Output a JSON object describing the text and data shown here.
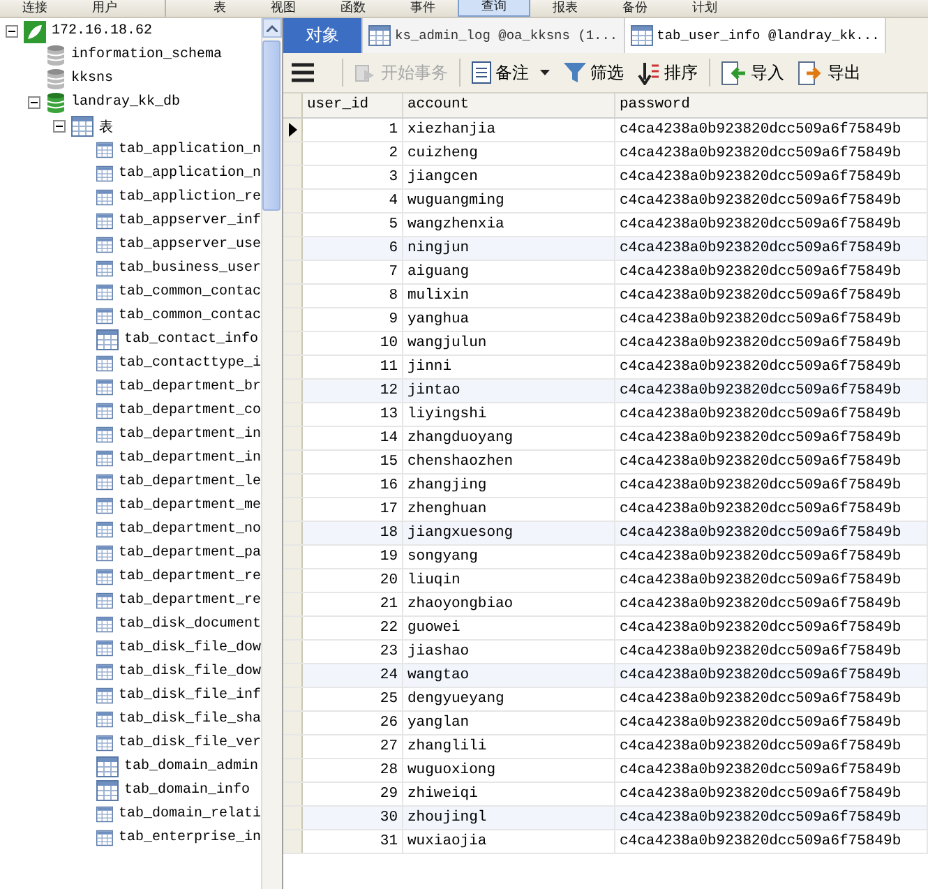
{
  "menu_bar": {
    "items": [
      {
        "label": "连接",
        "selected": false
      },
      {
        "label": "用户",
        "selected": false
      },
      {
        "label": "表",
        "selected": false
      },
      {
        "label": "视图",
        "selected": false
      },
      {
        "label": "函数",
        "selected": false
      },
      {
        "label": "事件",
        "selected": false
      },
      {
        "label": "查询",
        "selected": true
      },
      {
        "label": "报表",
        "selected": false
      },
      {
        "label": "备份",
        "selected": false
      },
      {
        "label": "计划",
        "selected": false
      }
    ]
  },
  "tree": {
    "items": [
      {
        "label": "172.16.18.62",
        "kind": "server",
        "expanded": true,
        "children": [
          {
            "label": "information_schema",
            "kind": "database"
          },
          {
            "label": "kksns",
            "kind": "database"
          },
          {
            "label": "landray_kk_db",
            "kind": "database",
            "expanded": true,
            "children": [
              {
                "label": "表",
                "kind": "folder",
                "expanded": true,
                "children": [
                  {
                    "label": "tab_application_n",
                    "kind": "table"
                  },
                  {
                    "label": "tab_application_n",
                    "kind": "table"
                  },
                  {
                    "label": "tab_appliction_re",
                    "kind": "table"
                  },
                  {
                    "label": "tab_appserver_inf",
                    "kind": "table"
                  },
                  {
                    "label": "tab_appserver_use",
                    "kind": "table"
                  },
                  {
                    "label": "tab_business_user",
                    "kind": "table"
                  },
                  {
                    "label": "tab_common_contac",
                    "kind": "table"
                  },
                  {
                    "label": "tab_common_contac",
                    "kind": "table"
                  },
                  {
                    "label": "tab_contact_info",
                    "kind": "table"
                  },
                  {
                    "label": "tab_contacttype_i",
                    "kind": "table"
                  },
                  {
                    "label": "tab_department_br",
                    "kind": "table"
                  },
                  {
                    "label": "tab_department_co",
                    "kind": "table"
                  },
                  {
                    "label": "tab_department_in",
                    "kind": "table"
                  },
                  {
                    "label": "tab_department_in",
                    "kind": "table"
                  },
                  {
                    "label": "tab_department_le",
                    "kind": "table"
                  },
                  {
                    "label": "tab_department_me",
                    "kind": "table"
                  },
                  {
                    "label": "tab_department_no",
                    "kind": "table"
                  },
                  {
                    "label": "tab_department_pa",
                    "kind": "table"
                  },
                  {
                    "label": "tab_department_re",
                    "kind": "table"
                  },
                  {
                    "label": "tab_department_re",
                    "kind": "table"
                  },
                  {
                    "label": "tab_disk_document",
                    "kind": "table"
                  },
                  {
                    "label": "tab_disk_file_dow",
                    "kind": "table"
                  },
                  {
                    "label": "tab_disk_file_dow",
                    "kind": "table"
                  },
                  {
                    "label": "tab_disk_file_inf",
                    "kind": "table"
                  },
                  {
                    "label": "tab_disk_file_sha",
                    "kind": "table"
                  },
                  {
                    "label": "tab_disk_file_ver",
                    "kind": "table"
                  },
                  {
                    "label": "tab_domain_admin",
                    "kind": "table"
                  },
                  {
                    "label": "tab_domain_info",
                    "kind": "table"
                  },
                  {
                    "label": "tab_domain_relati",
                    "kind": "table"
                  },
                  {
                    "label": "tab_enterprise_in",
                    "kind": "table"
                  }
                ]
              }
            ]
          }
        ]
      }
    ]
  },
  "tabs": [
    {
      "label": "对象",
      "kind": "objects",
      "selected": false
    },
    {
      "label": "ks_admin_log @oa_kksns (1...",
      "kind": "table",
      "selected": false
    },
    {
      "label": "tab_user_info @landray_kk...",
      "kind": "table",
      "selected": true
    }
  ],
  "toolbar": {
    "items": [
      {
        "kind": "menu"
      },
      {
        "kind": "transaction",
        "label": "开始事务",
        "disabled": true
      },
      {
        "kind": "note",
        "label": "备注",
        "disabled": false
      },
      {
        "kind": "filter",
        "label": "筛选",
        "disabled": false
      },
      {
        "kind": "sort",
        "label": "排序",
        "disabled": false
      },
      {
        "kind": "import",
        "label": "导入",
        "disabled": false
      },
      {
        "kind": "export",
        "label": "导出",
        "disabled": false
      }
    ]
  },
  "table": {
    "columns": [
      "user_id",
      "account",
      "password"
    ],
    "rows": [
      {
        "selected": true,
        "cells": [
          "1",
          "xiezhanjia",
          "c4ca4238a0b923820dcc509a6f75849b"
        ]
      },
      {
        "selected": false,
        "cells": [
          "2",
          "cuizheng",
          "c4ca4238a0b923820dcc509a6f75849b"
        ]
      },
      {
        "selected": false,
        "cells": [
          "3",
          "jiangcen",
          "c4ca4238a0b923820dcc509a6f75849b"
        ]
      },
      {
        "selected": false,
        "cells": [
          "4",
          "wuguangming",
          "c4ca4238a0b923820dcc509a6f75849b"
        ]
      },
      {
        "selected": false,
        "cells": [
          "5",
          "wangzhenxia",
          "c4ca4238a0b923820dcc509a6f75849b"
        ]
      },
      {
        "selected": false,
        "cells": [
          "6",
          "ningjun",
          "c4ca4238a0b923820dcc509a6f75849b"
        ]
      },
      {
        "selected": false,
        "cells": [
          "7",
          "aiguang",
          "c4ca4238a0b923820dcc509a6f75849b"
        ]
      },
      {
        "selected": false,
        "cells": [
          "8",
          "mulixin",
          "c4ca4238a0b923820dcc509a6f75849b"
        ]
      },
      {
        "selected": false,
        "cells": [
          "9",
          "yanghua",
          "c4ca4238a0b923820dcc509a6f75849b"
        ]
      },
      {
        "selected": false,
        "cells": [
          "10",
          "wangjulun",
          "c4ca4238a0b923820dcc509a6f75849b"
        ]
      },
      {
        "selected": false,
        "cells": [
          "11",
          "jinni",
          "c4ca4238a0b923820dcc509a6f75849b"
        ]
      },
      {
        "selected": false,
        "cells": [
          "12",
          "jintao",
          "c4ca4238a0b923820dcc509a6f75849b"
        ]
      },
      {
        "selected": false,
        "cells": [
          "13",
          "liyingshi",
          "c4ca4238a0b923820dcc509a6f75849b"
        ]
      },
      {
        "selected": false,
        "cells": [
          "14",
          "zhangduoyang",
          "c4ca4238a0b923820dcc509a6f75849b"
        ]
      },
      {
        "selected": false,
        "cells": [
          "15",
          "chenshaozhen",
          "c4ca4238a0b923820dcc509a6f75849b"
        ]
      },
      {
        "selected": false,
        "cells": [
          "16",
          "zhangjing",
          "c4ca4238a0b923820dcc509a6f75849b"
        ]
      },
      {
        "selected": false,
        "cells": [
          "17",
          "zhenghuan",
          "c4ca4238a0b923820dcc509a6f75849b"
        ]
      },
      {
        "selected": false,
        "cells": [
          "18",
          "jiangxuesong",
          "c4ca4238a0b923820dcc509a6f75849b"
        ]
      },
      {
        "selected": false,
        "cells": [
          "19",
          "songyang",
          "c4ca4238a0b923820dcc509a6f75849b"
        ]
      },
      {
        "selected": false,
        "cells": [
          "20",
          "liuqin",
          "c4ca4238a0b923820dcc509a6f75849b"
        ]
      },
      {
        "selected": false,
        "cells": [
          "21",
          "zhaoyongbiao",
          "c4ca4238a0b923820dcc509a6f75849b"
        ]
      },
      {
        "selected": false,
        "cells": [
          "22",
          "guowei",
          "c4ca4238a0b923820dcc509a6f75849b"
        ]
      },
      {
        "selected": false,
        "cells": [
          "23",
          "jiashao",
          "c4ca4238a0b923820dcc509a6f75849b"
        ]
      },
      {
        "selected": false,
        "cells": [
          "24",
          "wangtao",
          "c4ca4238a0b923820dcc509a6f75849b"
        ]
      },
      {
        "selected": false,
        "cells": [
          "25",
          "dengyueyang",
          "c4ca4238a0b923820dcc509a6f75849b"
        ]
      },
      {
        "selected": false,
        "cells": [
          "26",
          "yanglan",
          "c4ca4238a0b923820dcc509a6f75849b"
        ]
      },
      {
        "selected": false,
        "cells": [
          "27",
          "zhanglili",
          "c4ca4238a0b923820dcc509a6f75849b"
        ]
      },
      {
        "selected": false,
        "cells": [
          "28",
          "wuguoxiong",
          "c4ca4238a0b923820dcc509a6f75849b"
        ]
      },
      {
        "selected": false,
        "cells": [
          "29",
          "zhiweiqi",
          "c4ca4238a0b923820dcc509a6f75849b"
        ]
      },
      {
        "selected": false,
        "cells": [
          "30",
          "zhoujingl",
          "c4ca4238a0b923820dcc509a6f75849b"
        ]
      },
      {
        "selected": false,
        "cells": [
          "31",
          "wuxiaojia",
          "c4ca4238a0b923820dcc509a6f75849b"
        ]
      }
    ]
  }
}
